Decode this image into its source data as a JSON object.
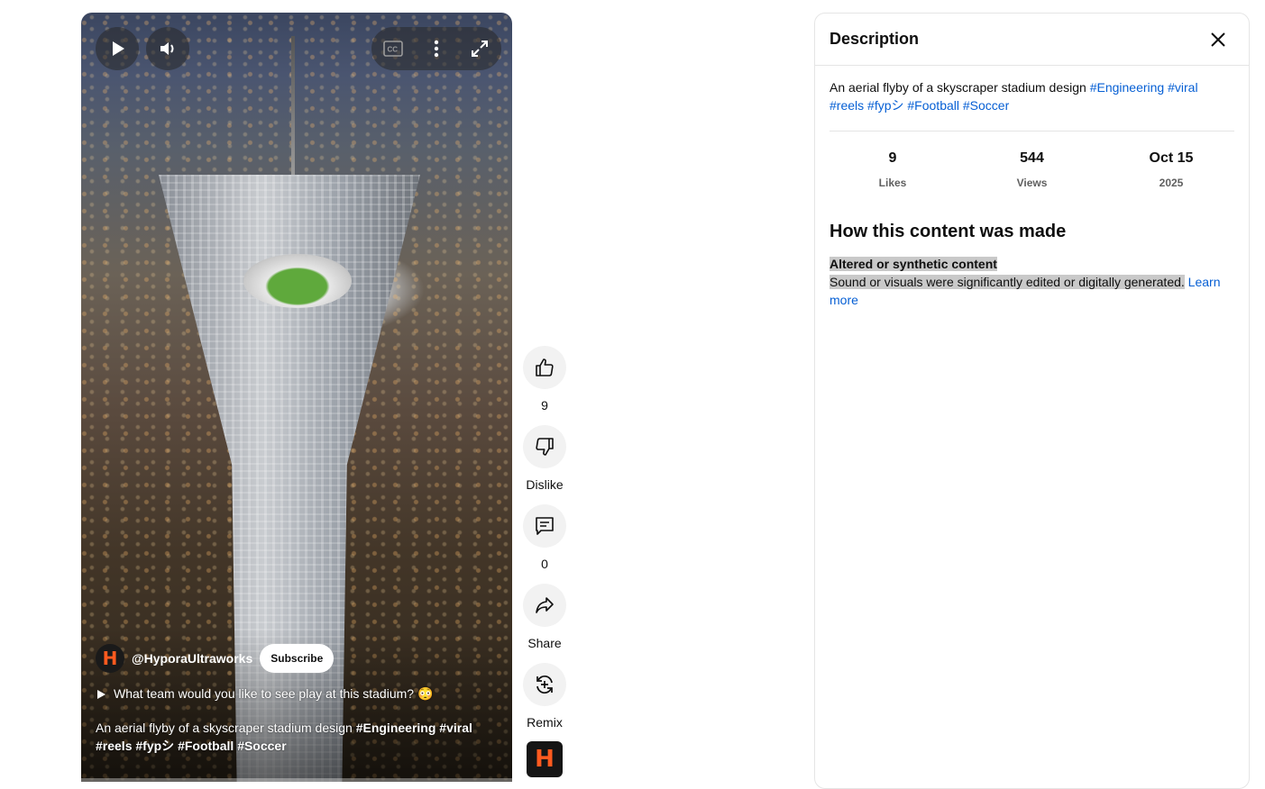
{
  "video": {
    "channel_handle": "@HyporaUltraworks",
    "subscribe_label": "Subscribe",
    "avatar_letter": "H",
    "question": "What team would you like to see play at this stadium? 😳",
    "caption_text": "An aerial flyby of a skyscraper stadium design ",
    "caption_tags": [
      "#Engineering",
      "#viral",
      "#reels",
      "#fypシ",
      "#Football",
      "#Soccer"
    ],
    "controls": {
      "play_icon": "play-icon",
      "volume_icon": "volume-icon",
      "cc_icon": "captions-icon",
      "more_icon": "more-vert-icon",
      "fullscreen_icon": "fullscreen-icon"
    }
  },
  "actions": {
    "like_count": "9",
    "dislike_label": "Dislike",
    "comment_count": "0",
    "share_label": "Share",
    "remix_label": "Remix"
  },
  "panel": {
    "title": "Description",
    "description_text": "An aerial flyby of a skyscraper stadium design ",
    "tags": [
      "#Engineering",
      "#viral",
      "#reels",
      "#fypシ",
      "#Football",
      "#Soccer"
    ],
    "stats": {
      "likes_value": "9",
      "likes_label": "Likes",
      "views_value": "544",
      "views_label": "Views",
      "date_value": "Oct 15",
      "date_year": "2025"
    },
    "how_made_heading": "How this content was made",
    "altered_title": "Altered or synthetic content",
    "altered_body": "Sound or visuals were significantly edited or digitally generated.",
    "learn_more": "Learn more"
  },
  "colors": {
    "link": "#065fd4",
    "highlight": "#c9c9c9",
    "accent_logo": "#ff5a1f"
  }
}
